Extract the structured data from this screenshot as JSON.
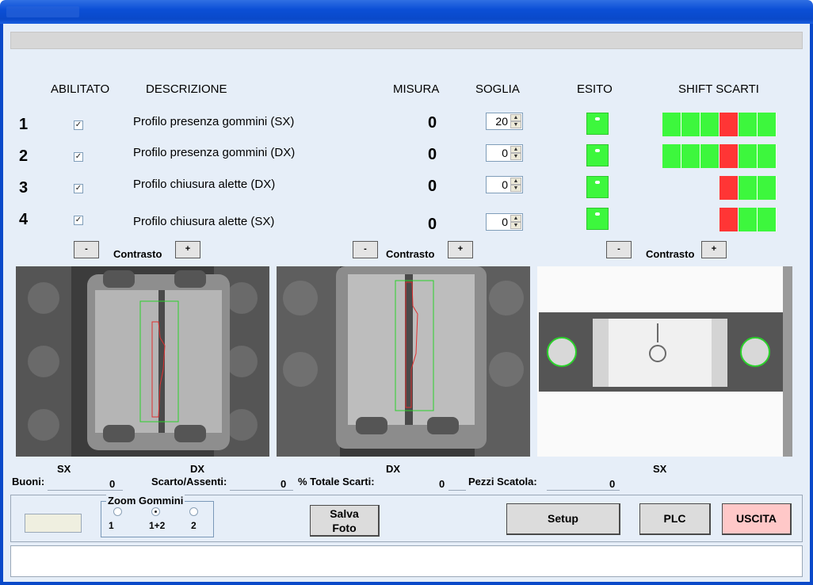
{
  "colors": {
    "ok_green": "#3df73d",
    "reject_red": "#ff3535",
    "exit_bg": "#ffc8c8"
  },
  "headers": {
    "enabled": "ABILITATO",
    "description": "DESCRIZIONE",
    "measure": "MISURA",
    "threshold": "SOGLIA",
    "result": "ESITO",
    "shift": "SHIFT SCARTI"
  },
  "rows": [
    {
      "num": "1",
      "enabled": true,
      "description": "Profilo presenza gommini (SX)",
      "measure": "0",
      "threshold": "20",
      "shift": [
        "ok",
        "ok",
        "ok",
        "reject",
        "ok",
        "ok"
      ]
    },
    {
      "num": "2",
      "enabled": true,
      "description": "Profilo presenza gommini (DX)",
      "measure": "0",
      "threshold": "0",
      "shift": [
        "ok",
        "ok",
        "ok",
        "reject",
        "ok",
        "ok"
      ]
    },
    {
      "num": "3",
      "enabled": true,
      "description": "Profilo chiusura alette (DX)",
      "measure": "0",
      "threshold": "0",
      "shift": [
        "reject",
        "ok",
        "ok"
      ]
    },
    {
      "num": "4",
      "enabled": true,
      "description": "Profilo chiusura alette (SX)",
      "measure": "0",
      "threshold": "0",
      "shift": [
        "reject",
        "ok",
        "ok"
      ]
    }
  ],
  "contrast": {
    "minus": "-",
    "plus": "+",
    "label": "Contrasto"
  },
  "image_labels": {
    "img1_left": "SX",
    "img1_right": "DX",
    "img2": "DX",
    "img3": "SX"
  },
  "stats": {
    "good_label": "Buoni:",
    "good_value": "0",
    "reject_label": "Scarto/Assenti:",
    "reject_value": "0",
    "total_reject_label": "% Totale Scarti:",
    "total_reject_value": "0",
    "box_label": "Pezzi Scatola:",
    "box_value": "0"
  },
  "zoom": {
    "title": "Zoom Gommini",
    "options": [
      {
        "label": "1",
        "selected": false
      },
      {
        "label": "1+2",
        "selected": true
      },
      {
        "label": "2",
        "selected": false
      }
    ]
  },
  "buttons": {
    "save_photo_line1": "Salva",
    "save_photo_line2": "Foto",
    "setup": "Setup",
    "plc": "PLC",
    "exit": "USCITA"
  }
}
